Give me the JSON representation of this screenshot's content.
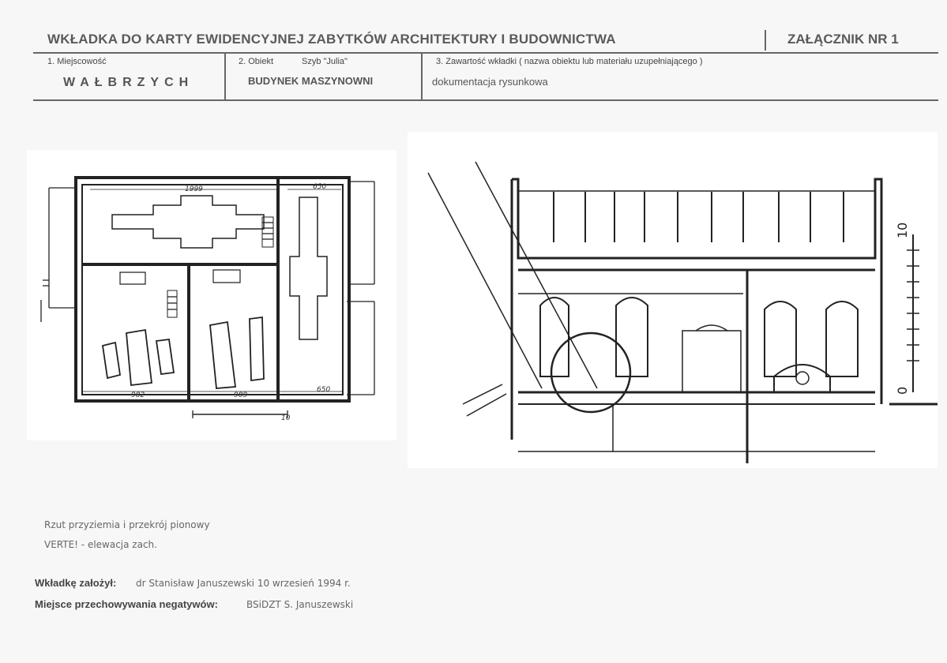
{
  "header": {
    "title": "WKŁADKA DO KARTY EWIDENCYJNEJ ZABYTKÓW ARCHITEKTURY I BUDOWNICTWA",
    "attachment": "ZAŁĄCZNIK NR 1"
  },
  "fields": {
    "locality_label": "1. Miejscowość",
    "locality_value": "WAŁBRZYCH",
    "object_label": "2. Obiekt",
    "object_shaft": "Szyb \"Julia\"",
    "object_value": "BUDYNEK MASZYNOWNI",
    "contents_label": "3. Zawartość wkładki ( nazwa obiektu lub materiału uzupełniającego )",
    "contents_value": "dokumentacja rysunkowa"
  },
  "plan": {
    "dim_top": "1999",
    "dim_right_top": "650",
    "dim_bottom_left": "982",
    "dim_bottom_mid": "989",
    "dim_bottom_right": "650",
    "scale_label": "10"
  },
  "section": {
    "scale_top": "10",
    "scale_bottom": "0"
  },
  "notes": {
    "line1": "Rzut przyziemia i przekrój pionowy",
    "line2": "VERTE! - elewacja zach."
  },
  "footer": {
    "founded_label": "Wkładkę założył:",
    "founded_value": "dr Stanisław Januszewski 10 wrzesień 1994 r.",
    "storage_label": "Miejsce przechowywania negatywów:",
    "storage_value": "BSiDZT S. Januszewski"
  }
}
